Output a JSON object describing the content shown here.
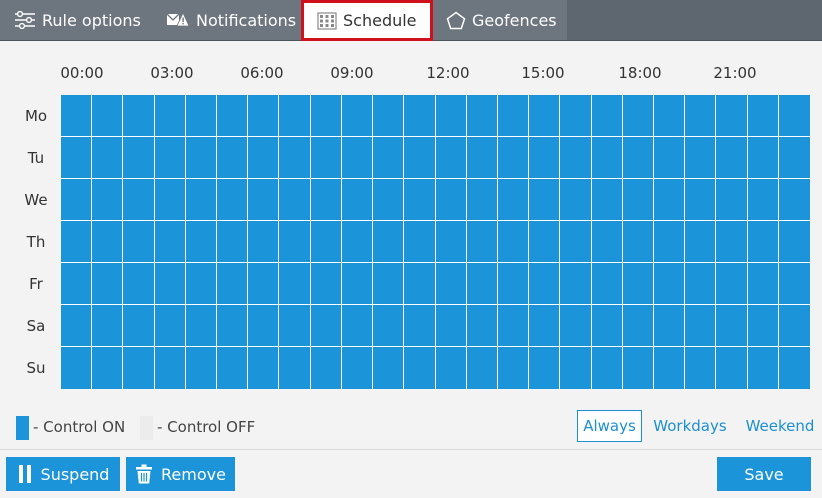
{
  "tabs": [
    {
      "label": "Rule options",
      "icon": "sliders-icon"
    },
    {
      "label": "Notifications",
      "icon": "envelope-warning-icon"
    },
    {
      "label": "Schedule",
      "icon": "calendar-grid-icon",
      "active": true
    },
    {
      "label": "Geofences",
      "icon": "pentagon-icon"
    }
  ],
  "schedule": {
    "hour_labels": [
      "00:00",
      "03:00",
      "06:00",
      "09:00",
      "12:00",
      "15:00",
      "18:00",
      "21:00"
    ],
    "days": [
      "Mo",
      "Tu",
      "We",
      "Th",
      "Fr",
      "Sa",
      "Su"
    ],
    "hours_per_day": 24,
    "all_on": true,
    "on_color": "#1c94d9",
    "off_color": "#ececec"
  },
  "legend": {
    "on_label": "- Control ON",
    "off_label": "- Control OFF"
  },
  "presets": {
    "always": "Always",
    "workdays": "Workdays",
    "weekend": "Weekend",
    "selected": "Always"
  },
  "footer": {
    "suspend_label": "Suspend",
    "remove_label": "Remove",
    "save_label": "Save"
  },
  "colors": {
    "accent": "#1c94d9",
    "active_tab_border": "#d0101b",
    "tabbar": "#5e6670"
  }
}
